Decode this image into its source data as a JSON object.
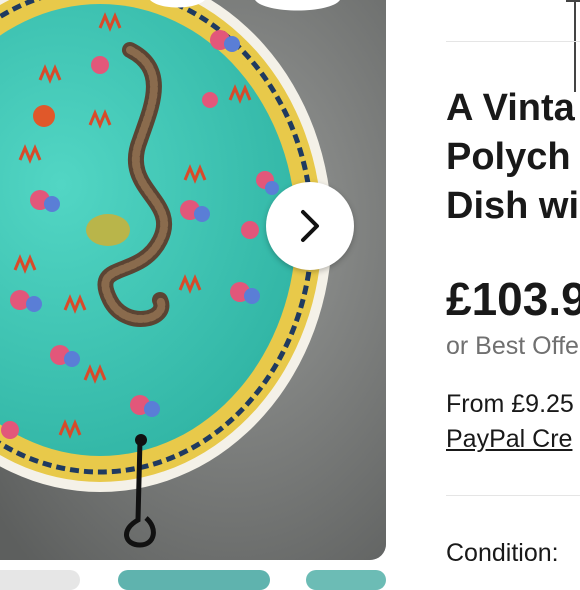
{
  "gallery": {
    "image_alt_icon": "dragon-plate-photo",
    "next_icon": "chevron-right-icon",
    "colors": {
      "plate_turquoise": "#3fc2b2",
      "rim_yellow": "#e8c94a",
      "backdrop": "#8a8c8a"
    }
  },
  "listing": {
    "title_lines": [
      "A Vinta",
      "Polych",
      "Dish wi"
    ],
    "price": "£103.9",
    "best_offer": "or Best Offe",
    "from_text": "From £9.25",
    "paypal_link": "PayPal Cre",
    "condition_label": "Condition:"
  }
}
